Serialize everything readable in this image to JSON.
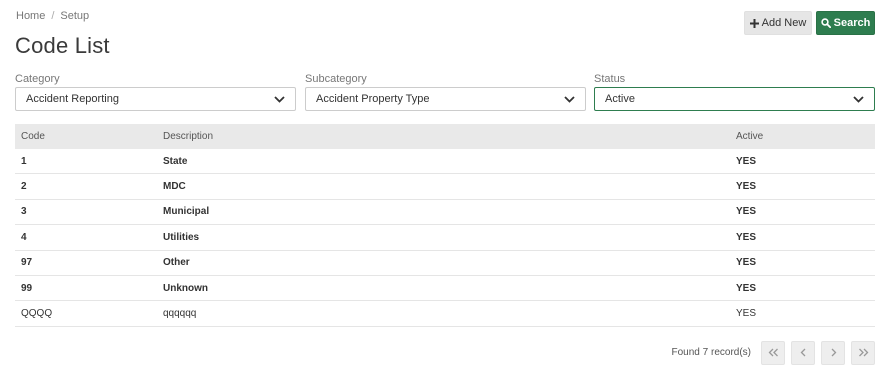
{
  "breadcrumb": {
    "home": "Home",
    "separator": "/",
    "current": "Setup"
  },
  "page_title": "Code List",
  "toolbar": {
    "add_label": "Add New",
    "add_icon": "plus-icon",
    "search_label": "Search",
    "search_icon": "search-icon",
    "search_color": "#2e7d4f"
  },
  "filters": {
    "category": {
      "label": "Category",
      "value": "Accident Reporting"
    },
    "subcategory": {
      "label": "Subcategory",
      "value": "Accident Property Type"
    },
    "status": {
      "label": "Status",
      "value": "Active"
    }
  },
  "table": {
    "headers": {
      "code": "Code",
      "description": "Description",
      "active": "Active"
    },
    "rows": [
      {
        "code": "1",
        "description": "State",
        "active": "YES"
      },
      {
        "code": "2",
        "description": "MDC",
        "active": "YES"
      },
      {
        "code": "3",
        "description": "Municipal",
        "active": "YES"
      },
      {
        "code": "4",
        "description": "Utilities",
        "active": "YES"
      },
      {
        "code": "97",
        "description": "Other",
        "active": "YES"
      },
      {
        "code": "99",
        "description": "Unknown",
        "active": "YES"
      },
      {
        "code": "QQQQ",
        "description": "qqqqqq",
        "active": "YES"
      }
    ]
  },
  "footer": {
    "found_text": "Found 7 record(s)",
    "pager_icons": [
      "first-page-icon",
      "previous-page-icon",
      "next-page-icon",
      "last-page-icon"
    ]
  }
}
